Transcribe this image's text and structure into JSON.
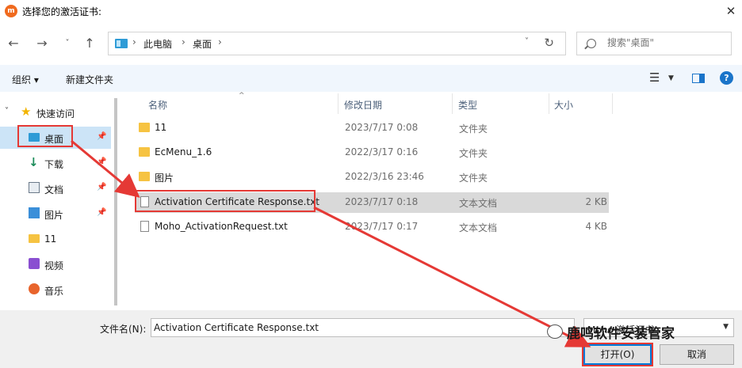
{
  "window": {
    "title": "选择您的激活证书:",
    "app_icon_text": "m"
  },
  "nav": {
    "address": {
      "segment1": "此电脑",
      "segment2": "桌面"
    },
    "search_placeholder": "搜索\"桌面\""
  },
  "toolbar": {
    "organize_label": "组织 ▾",
    "new_folder_label": "新建文件夹"
  },
  "sidebar": {
    "items": [
      {
        "label": "快速访问"
      },
      {
        "label": "桌面"
      },
      {
        "label": "下载"
      },
      {
        "label": "文档"
      },
      {
        "label": "图片"
      },
      {
        "label": "11"
      },
      {
        "label": "视频"
      },
      {
        "label": "音乐"
      }
    ]
  },
  "columns": {
    "name": "名称",
    "date": "修改日期",
    "type": "类型",
    "size": "大小"
  },
  "files": [
    {
      "name": "11",
      "date": "2023/7/17 0:08",
      "type": "文件夹",
      "size": ""
    },
    {
      "name": "EcMenu_1.6",
      "date": "2022/3/17 0:16",
      "type": "文件夹",
      "size": ""
    },
    {
      "name": "图片",
      "date": "2022/3/16 23:46",
      "type": "文件夹",
      "size": ""
    },
    {
      "name": "Activation Certificate Response.txt",
      "date": "2023/7/17 0:18",
      "type": "文本文档",
      "size": "2 KB"
    },
    {
      "name": "Moho_ActivationRequest.txt",
      "date": "2023/7/17 0:17",
      "type": "文本文档",
      "size": "4 KB"
    }
  ],
  "bottom": {
    "filename_label": "文件名(N):",
    "filename_value": "Activation Certificate Response.txt",
    "filetype_value": "Moho 激活证书",
    "open_label": "打开(O)",
    "cancel_label": "取消"
  },
  "watermark_text": "鹿鸣软件安装管家",
  "colors": {
    "accent": "#0078d7",
    "annotation": "#e53935",
    "selection": "#cce4f7"
  }
}
